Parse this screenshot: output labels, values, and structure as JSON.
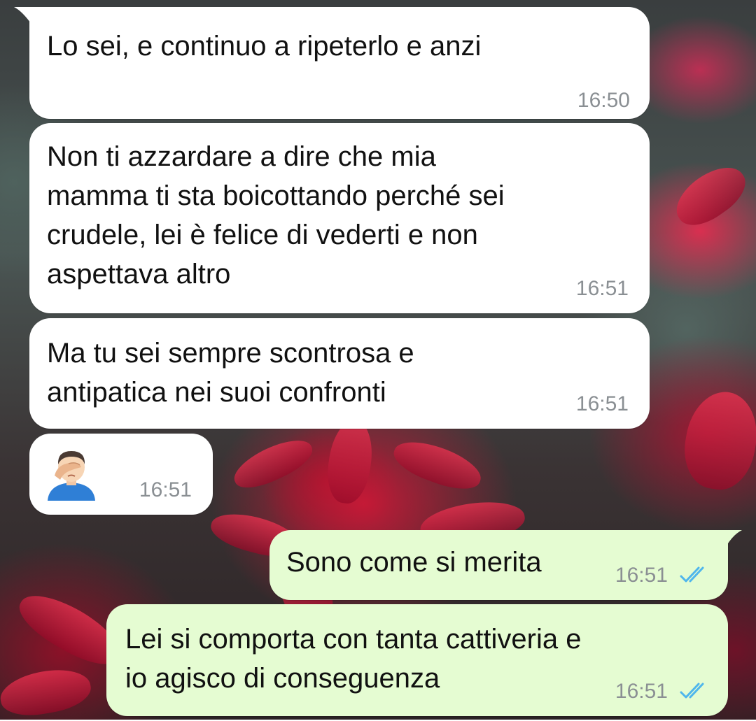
{
  "messages": [
    {
      "direction": "in",
      "text": "Lo sei, e continuo a ripeterlo e anzi",
      "time": "16:50"
    },
    {
      "direction": "in",
      "text": "Non ti azzardare a dire che mia\nmamma ti sta boicottando perché sei\ncrudele, lei è felice di vederti e non\naspettava altro",
      "time": "16:51"
    },
    {
      "direction": "in",
      "text": "Ma tu sei sempre scontrosa e\nantipatica nei suoi confronti",
      "time": "16:51"
    },
    {
      "direction": "in",
      "emoji": "man-facepalming-icon",
      "time": "16:51"
    },
    {
      "direction": "out",
      "text": "Sono come si merita",
      "time": "16:51",
      "status": "read"
    },
    {
      "direction": "out",
      "text": "Lei si comporta con tanta cattiveria e\nio agisco di conseguenza",
      "time": "16:51",
      "status": "read"
    }
  ],
  "colors": {
    "incoming_bubble": "#ffffff",
    "outgoing_bubble": "#e5fcd2",
    "read_tick": "#4fb6ec",
    "time_text": "#8a8f93"
  }
}
